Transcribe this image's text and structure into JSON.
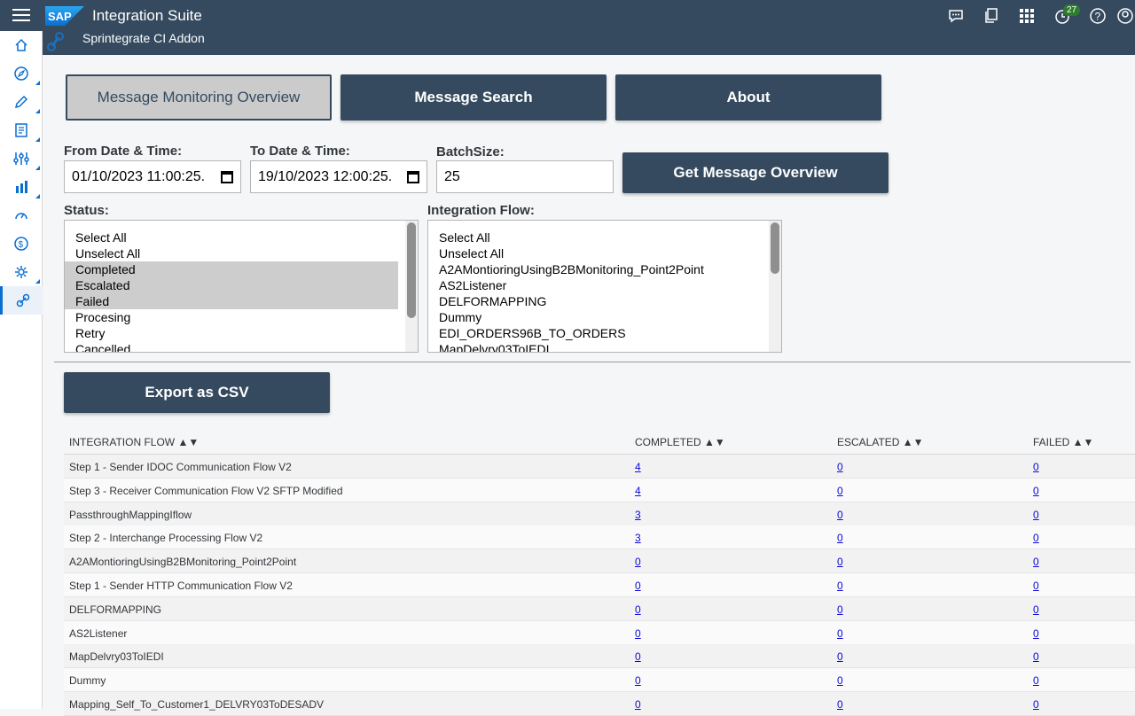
{
  "shell": {
    "logo_text": "SAP",
    "title": "Integration Suite",
    "subtitle": "Sprintegrate CI Addon",
    "notification_count": "27",
    "icons": [
      "feedback-icon",
      "copy-icon",
      "app-grid-icon",
      "notification-icon",
      "help-icon",
      "user-icon"
    ]
  },
  "sidenav": {
    "items": [
      "home-icon",
      "discover-icon",
      "design-icon",
      "monitor-icon",
      "configure-icon",
      "analytics-icon",
      "performance-icon",
      "cost-icon",
      "settings-icon",
      "addon-link-icon"
    ]
  },
  "tabs": {
    "overview": "Message Monitoring Overview",
    "search": "Message Search",
    "about": "About"
  },
  "filters": {
    "from_label": "From Date & Time:",
    "from_value": "01/10/2023 11:00:25.",
    "to_label": "To Date & Time:",
    "to_value": "19/10/2023 12:00:25.",
    "batch_label": "BatchSize:",
    "batch_value": "25",
    "get_button": "Get Message Overview",
    "status_label": "Status:",
    "status_options": [
      {
        "label": "Select All",
        "selected": false
      },
      {
        "label": "Unselect All",
        "selected": false
      },
      {
        "label": "Completed",
        "selected": true
      },
      {
        "label": "Escalated",
        "selected": true
      },
      {
        "label": "Failed",
        "selected": true
      },
      {
        "label": "Procesing",
        "selected": false
      },
      {
        "label": "Retry",
        "selected": false
      },
      {
        "label": "Cancelled",
        "selected": false
      }
    ],
    "flow_label": "Integration Flow:",
    "flow_options": [
      "Select All",
      "Unselect All",
      "A2AMontioringUsingB2BMonitoring_Point2Point",
      "AS2Listener",
      "DELFORMAPPING",
      "Dummy",
      "EDI_ORDERS96B_TO_ORDERS",
      "MapDelvry03ToIEDI"
    ]
  },
  "export_button": "Export as CSV",
  "table": {
    "headers": [
      "INTEGRATION FLOW ▲▼",
      "COMPLETED ▲▼",
      "ESCALATED ▲▼",
      "FAILED ▲▼"
    ],
    "rows": [
      [
        "Step 1 - Sender IDOC Communication Flow V2",
        "4",
        "0",
        "0"
      ],
      [
        "Step 3 - Receiver Communication Flow V2 SFTP Modified",
        "4",
        "0",
        "0"
      ],
      [
        "PassthroughMappingIflow",
        "3",
        "0",
        "0"
      ],
      [
        "Step 2 - Interchange Processing Flow V2",
        "3",
        "0",
        "0"
      ],
      [
        "A2AMontioringUsingB2BMonitoring_Point2Point",
        "0",
        "0",
        "0"
      ],
      [
        "Step 1 - Sender HTTP Communication Flow V2",
        "0",
        "0",
        "0"
      ],
      [
        "DELFORMAPPING",
        "0",
        "0",
        "0"
      ],
      [
        "AS2Listener",
        "0",
        "0",
        "0"
      ],
      [
        "MapDelvry03ToIEDI",
        "0",
        "0",
        "0"
      ],
      [
        "Dummy",
        "0",
        "0",
        "0"
      ],
      [
        "Mapping_Self_To_Customer1_DELVRY03ToDESADV",
        "0",
        "0",
        "0"
      ]
    ]
  },
  "colors": {
    "shell": "#354a5f",
    "button": "#354a5f",
    "link": "#0a0ad8",
    "badge": "#2b7d2b"
  }
}
